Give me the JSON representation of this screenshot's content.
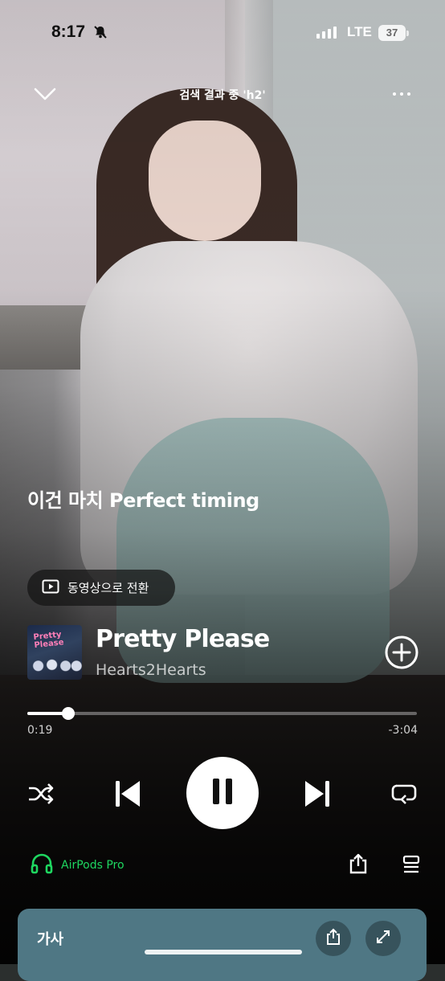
{
  "status_bar": {
    "time": "8:17",
    "network": "LTE",
    "battery": "37",
    "icons": [
      "bell-slash-icon",
      "signal-icon",
      "battery-icon"
    ]
  },
  "header": {
    "context_title": "검색 결과 중 'h2'",
    "icons": [
      "chevron-down-icon",
      "more-icon"
    ]
  },
  "lyric_line": "이건 마치 Perfect timing",
  "video_toggle": {
    "label": "동영상으로 전환",
    "icon": "video-icon"
  },
  "track": {
    "art_text": "Pretty Please",
    "title": "Pretty Please",
    "artist": "Hearts2Hearts",
    "add_icon": "plus-circle-icon"
  },
  "progress": {
    "elapsed": "0:19",
    "remaining": "-3:04",
    "fraction": 0.106
  },
  "controls": {
    "icons": [
      "shuffle-icon",
      "previous-icon",
      "pause-icon",
      "next-icon",
      "repeat-icon"
    ]
  },
  "device": {
    "label": "AirPods Pro",
    "color": "#1ed760",
    "icon": "headphones-icon"
  },
  "bottom_icons": [
    "share-icon",
    "queue-icon"
  ],
  "lyrics_card": {
    "label": "가사",
    "color": "#4f7784",
    "icons": [
      "share-icon",
      "expand-icon"
    ]
  }
}
